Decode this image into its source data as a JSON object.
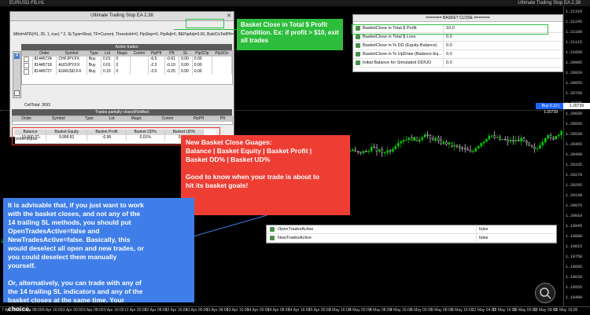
{
  "window": {
    "title": "EURUSD-FB,H1",
    "right_label": "Ultimate Trailing Stop EA 2.38"
  },
  "chart": {
    "price_ticks": [
      "1.21310",
      "1.21245",
      "1.21180",
      "1.21115",
      "1.21050",
      "1.20985",
      "1.20920",
      "1.20855",
      "1.20790",
      "1.20725",
      "1.20660",
      "1.20595",
      "1.20530",
      "1.20465",
      "1.20400",
      "1.20335",
      "1.20270",
      "1.20205",
      "1.20140",
      "1.20075",
      "1.20010",
      "1.19945",
      "1.19880",
      "1.19815",
      "1.19750",
      "1.19685",
      "1.19620",
      "1.19555",
      "1.19490"
    ],
    "time_ticks": [
      "7 Apr 2021",
      "8 Apr 08:00",
      "8 Apr 16:00",
      "9 Apr 00:00",
      "9 Apr 08:00",
      "9 Apr 16:00",
      "12 Apr 00:00",
      "12 Apr 08:00",
      "12 Apr 16:00",
      "13 Apr 00:00",
      "13 Apr 08:00",
      "13 Apr 16:00",
      "14 Apr 00:00",
      "14 Apr 08:00",
      "14 Apr 16:00",
      "15 Apr 00:00",
      "3 May 16:00",
      "4 May 00:00",
      "4 May 08:00",
      "4 May 16:00",
      "5 May 00:00",
      "5 May 08:00",
      "6 May 16:00",
      "12 May 04:00",
      "12 May 16:00",
      "13 May 00:00",
      "13 May 08:00",
      "13 May 16:00"
    ],
    "buy_label": "Buy 0.10 | 1.20739",
    "last_price": "1.20739"
  },
  "ea_panel": {
    "title": "Ultimate Trailing Stop EA 2.38",
    "params": "Mthd=ATR(H1, 25, 1, true) * 2, SLType=Real, TF=Current, Threshold=0, PipStep=0, PipAdj=0, BEPipAdj=0.00,",
    "bskt_param": "BsktClsTotlPft=10.00",
    "active_trades_header": "Active trades",
    "active_cols": [
      "Order",
      "Symbol",
      "Type",
      "Lot",
      "Magic",
      "Comm",
      "PipPft",
      "Pft",
      "SL",
      "PipSOp",
      "PipSOc"
    ],
    "active_rows": [
      [
        "81445724",
        "CHFJPY.FX",
        "Buy",
        "0.01",
        "0",
        "",
        "-6.5",
        "-0.61",
        "0.00",
        "0.00",
        ""
      ],
      [
        "81445718",
        "AUDJPY.FX",
        "Buy",
        "0.01",
        "0",
        "",
        "-2.3",
        "-0.10",
        "0.00",
        "0.00",
        ""
      ],
      [
        "81445727",
        "EURUSD.FX",
        "Buy",
        "0.10",
        "0",
        "",
        "-2.0",
        "-0.25",
        "0.00",
        "0.00",
        ""
      ]
    ],
    "cell_total": "CellTotal: 3/0/3",
    "closed_header": "Trades partially closed/Notified",
    "closed_cols": [
      "Order",
      "Symbol",
      "Type",
      "Lot",
      "Magic",
      "Comm",
      "PipPft",
      "Pft"
    ],
    "gauge_cols": [
      "Balance",
      "Basket Equity",
      "Basket Profit",
      "Basket DD%",
      "Basket UD%"
    ],
    "gauge_values": [
      "10,000.77",
      "9,999.81",
      "-0.96",
      "0.01%",
      "0.00%"
    ],
    "symbol_equal": "Symbol Equal: *"
  },
  "callouts": {
    "green": "Basket Close in Total $ Profit Condition. Ex: if profit > $10, exit all trades",
    "red_lines": [
      "New Basket Close Guages:",
      "Balance | Basket Equity | Basket Profit |",
      "Basket DD% | Basket UD%",
      "",
      "Good to know when your trade is about to",
      "hit its basket goals!"
    ],
    "blue_lines": [
      "It is advisable that, if you just want to work",
      "with the basket closes, and not any of the",
      "14 trailing SL methods, you should put",
      "OpenTradesActive=false and",
      "NewTradesActive=false. Basically, this",
      "would deselect all open and new trades, or",
      "you could deselect them manually",
      "yourself.",
      "",
      "Or, alternatively, you can trade with any of",
      "the 14 trailing SL indicators and any of the",
      "basket closes at the same time. Your",
      "choice."
    ]
  },
  "basket_close_panel": {
    "header": "======= BASKET CLOSE =======",
    "rows": [
      {
        "name": "BasketClose in Total $ Profit",
        "value": "10.0"
      },
      {
        "name": "BasketClose in Total $ Loss",
        "value": "0.0"
      },
      {
        "name": "BasketClose in % DD (Equity-Balance)",
        "value": "0.0"
      },
      {
        "name": "BasketClose in % UpDraw (Balance-Eq...",
        "value": "0.0"
      },
      {
        "name": "Initial Balance for Simulated DD/UD",
        "value": "0.0"
      }
    ]
  },
  "open_trades_panel": {
    "rows": [
      {
        "name": "OpenTradesActive",
        "value": "false"
      },
      {
        "name": "NewTradesActive",
        "value": "false"
      }
    ]
  },
  "colors": {
    "green": "#2dbd3c",
    "red": "#ee3e34",
    "blue": "#3f7ee8",
    "bull_candle": "#00d400",
    "bear_candle": "#ffffff"
  }
}
